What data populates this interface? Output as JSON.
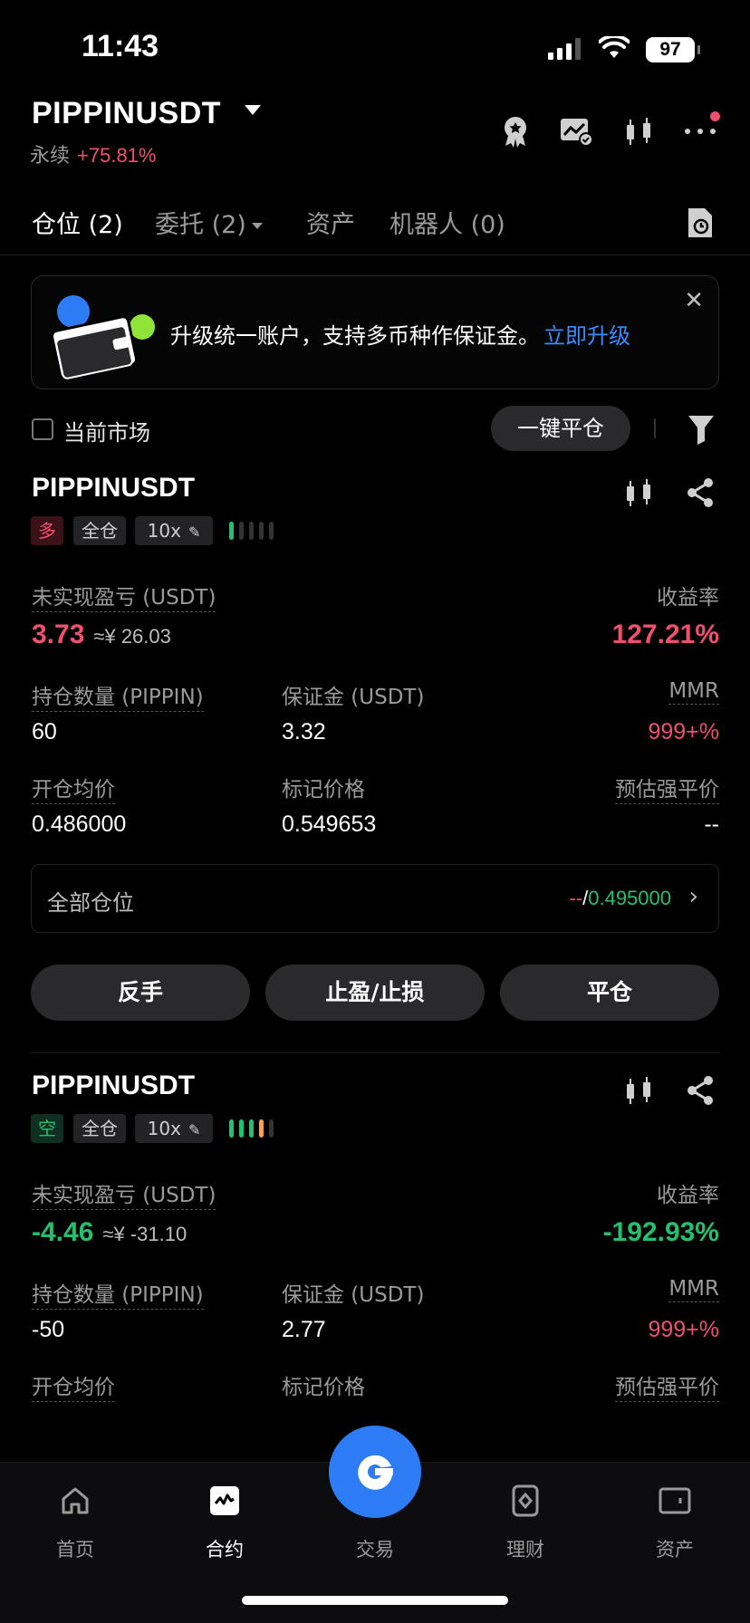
{
  "status_bar": {
    "time": "11:43",
    "battery": "97"
  },
  "header": {
    "symbol": "PIPPINUSDT",
    "type": "永续",
    "change": "+75.81%"
  },
  "tabs": [
    {
      "label": "仓位 (2)",
      "active": true
    },
    {
      "label": "委托 (2)",
      "active": false
    },
    {
      "label": "资产",
      "active": false
    },
    {
      "label": "机器人 (0)",
      "active": false
    }
  ],
  "banner": {
    "text": "升级统一账户，支持多币种作保证金。",
    "link": "立即升级"
  },
  "filter": {
    "current_market": "当前市场",
    "close_all": "一键平仓"
  },
  "labels": {
    "unrealized_pnl": "未实现盈亏 (USDT)",
    "roe": "收益率",
    "position_size": "持仓数量 (PIPPIN)",
    "margin": "保证金 (USDT)",
    "mmr": "MMR",
    "entry_price": "开仓均价",
    "mark_price": "标记价格",
    "liq_price": "预估强平价",
    "all_positions": "全部仓位"
  },
  "positions": [
    {
      "symbol": "PIPPINUSDT",
      "side": "多",
      "margin_mode": "全仓",
      "leverage": "10x",
      "pnl": "3.73",
      "pnl_cny": "≈¥ 26.03",
      "roe": "127.21%",
      "size": "60",
      "margin": "3.32",
      "mmr": "999+%",
      "entry_price": "0.486000",
      "mark_price": "0.549653",
      "liq_price": "--",
      "all_pos_a": "--",
      "all_pos_sep": "/",
      "all_pos_b": "0.495000",
      "actions": [
        "反手",
        "止盈/止损",
        "平仓"
      ]
    },
    {
      "symbol": "PIPPINUSDT",
      "side": "空",
      "margin_mode": "全仓",
      "leverage": "10x",
      "pnl": "-4.46",
      "pnl_cny": "≈¥ -31.10",
      "roe": "-192.93%",
      "size": "-50",
      "margin": "2.77",
      "mmr": "999+%"
    }
  ],
  "bottom_nav": [
    {
      "label": "首页",
      "icon": "home-icon"
    },
    {
      "label": "合约",
      "icon": "futures-icon",
      "active": true
    },
    {
      "label": "交易",
      "icon": "trade-icon"
    },
    {
      "label": "理财",
      "icon": "earn-icon"
    },
    {
      "label": "资产",
      "icon": "wallet-icon"
    }
  ],
  "colors": {
    "up": "#f0506e",
    "down": "#25c06d",
    "accent": "#2e7bf6",
    "link": "#3d8bff"
  }
}
